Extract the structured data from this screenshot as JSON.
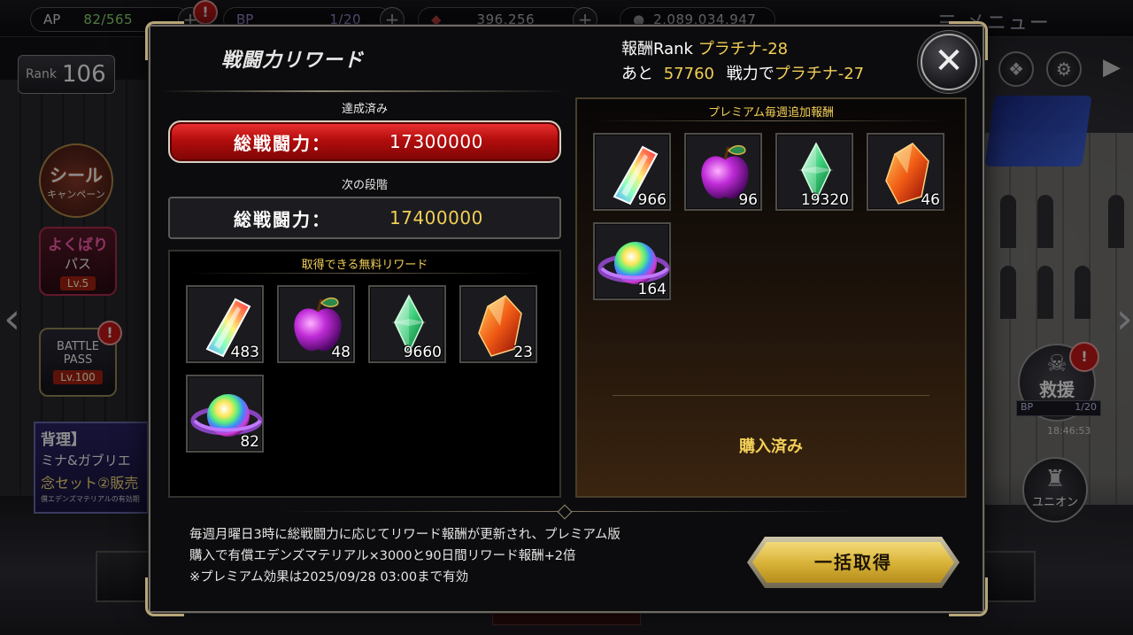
{
  "top_bar": {
    "ap_label": "AP",
    "ap_value": "82/565",
    "bp_label": "BP",
    "bp_value": "1/20",
    "material_value": "396,256",
    "gold_value": "2,089,034,947",
    "menu_label": "メニュー"
  },
  "left_side": {
    "rank_label": "Rank",
    "rank_value": "106",
    "seal_title": "シール",
    "seal_sub": "キャンペーン",
    "yokubari_title": "よくばり",
    "yokubari_sub": "パス",
    "yokubari_level": "Lv.5",
    "battlepass_line1": "BATTLE",
    "battlepass_line2": "PASS",
    "battlepass_level": "Lv.100",
    "banner_l1": "背理】",
    "banner_l2": "ミナ&ガブリエ",
    "banner_l3": "念セット②販売",
    "banner_l4": "償エデンズマテリアルの有効期",
    "notif_mark": "!"
  },
  "right_side": {
    "rescue_label": "救援",
    "bp_label": "BP",
    "bp_value": "1/20",
    "clock": "18:46:53",
    "union_label": "ユニオン"
  },
  "modal": {
    "title": "戦闘力リワード",
    "reward_rank_label": "報酬Rank",
    "reward_rank_value": "プラチナ-28",
    "remaining_prefix": "あと",
    "remaining_value": "57760",
    "remaining_mid": "戦力で",
    "next_rank_value": "プラチナ-27",
    "close_symbol": "✕",
    "achieved_label": "達成済み",
    "achieved_key": "総戦闘力：",
    "achieved_value": "17300000",
    "next_label": "次の段階",
    "next_key": "総戦闘力：",
    "next_value": "17400000",
    "free_header": "取得できる無料リワード",
    "free_items": [
      {
        "icon": "rainbow-crystal-icon",
        "qty": "483"
      },
      {
        "icon": "purple-apple-icon",
        "qty": "48"
      },
      {
        "icon": "green-gem-icon",
        "qty": "9660"
      },
      {
        "icon": "fire-stone-icon",
        "qty": "23"
      },
      {
        "icon": "rainbow-orb-icon",
        "qty": "82"
      }
    ],
    "premium_header": "プレミアム毎週追加報酬",
    "premium_items": [
      {
        "icon": "rainbow-crystal-icon",
        "qty": "966"
      },
      {
        "icon": "purple-apple-icon",
        "qty": "96"
      },
      {
        "icon": "green-gem-icon",
        "qty": "19320"
      },
      {
        "icon": "fire-stone-icon",
        "qty": "46"
      },
      {
        "icon": "rainbow-orb-icon",
        "qty": "164"
      }
    ],
    "purchased_label": "購入済み",
    "note_line1": "毎週月曜日3時に総戦闘力に応じてリワード報酬が更新され、プレミアム版",
    "note_line2": "購入で有償エデンズマテリアル×3000と90日間リワード報酬+2倍",
    "note_line3": "※プレミアム効果は2025/09/28 03:00まで有効",
    "claim_all_label": "一括取得"
  },
  "colors": {
    "accent_gold": "#f2cf57",
    "achieved_red": "#b30d0d",
    "panel_border": "#34322e"
  }
}
